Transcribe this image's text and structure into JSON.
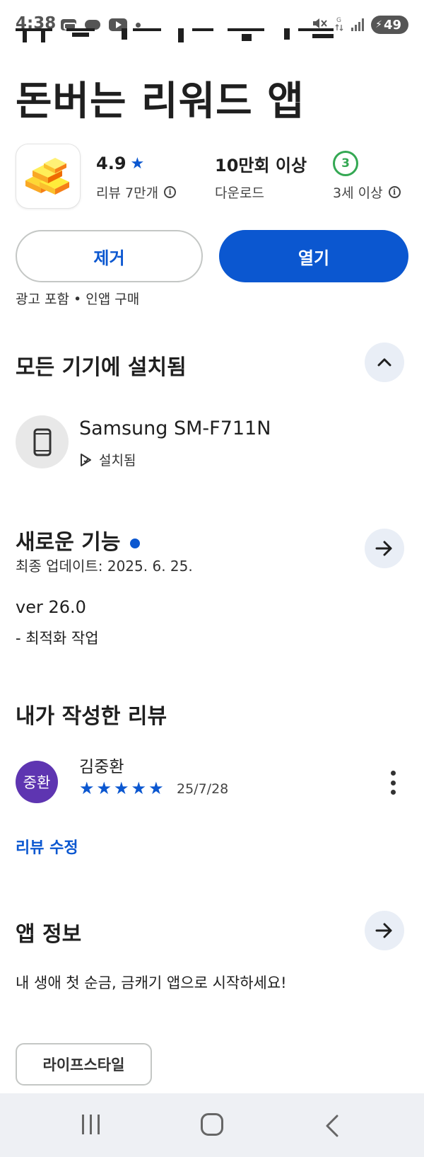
{
  "status_bar": {
    "time": "4:38",
    "battery": "49",
    "icons_left": [
      "voicemail-icon",
      "cloud-icon",
      "youtube-icon",
      "dot-icon"
    ],
    "icons_right": [
      "mute-icon",
      "data-icon",
      "signal-icon",
      "battery-icon"
    ]
  },
  "app": {
    "title_line2": "돈버는 리워드 앱",
    "rating": "4.9",
    "reviews": "리뷰 7만개",
    "downloads_value": "10만회 이상",
    "downloads_label": "다운로드",
    "age_badge": "3",
    "age_label": "3세 이상",
    "ad_info": "광고 포함 • 인앱 구매"
  },
  "actions": {
    "remove_label": "제거",
    "open_label": "열기"
  },
  "devices": {
    "title": "모든 기기에 설치됨",
    "device_name": "Samsung SM-F711N",
    "device_status": "설치됨"
  },
  "whats_new": {
    "title": "새로운 기능",
    "updated": "최종 업데이트: 2025. 6. 25.",
    "version": "ver 26.0",
    "change": "- 최적화 작업"
  },
  "my_review": {
    "title": "내가 작성한 리뷰",
    "avatar_text": "중환",
    "reviewer": "김중환",
    "rating": 5,
    "date": "25/7/28",
    "edit_label": "리뷰 수정"
  },
  "about": {
    "title": "앱 정보",
    "description": "내 생애 첫 순금, 금캐기 앱으로 시작하세요!",
    "category": "라이프스타일"
  },
  "colors": {
    "accent": "#0b57d0",
    "age_green": "#34a853",
    "avatar_purple": "#5e35b1",
    "round_button_bg": "#e9eef6"
  }
}
